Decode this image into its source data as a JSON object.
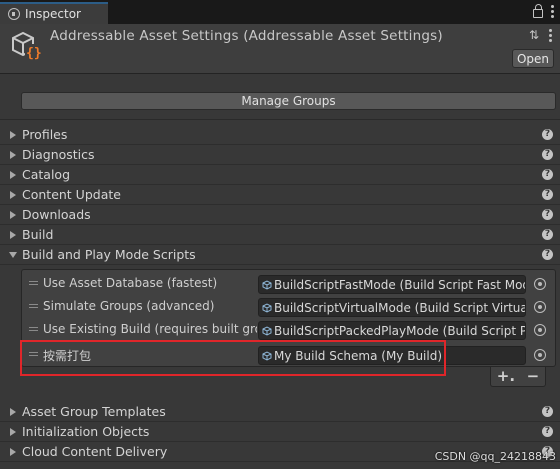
{
  "tab": {
    "label": "Inspector"
  },
  "header": {
    "title": "Addressable Asset Settings (Addressable Asset Settings)",
    "open_label": "Open"
  },
  "manage_groups_label": "Manage Groups",
  "sections_top": [
    {
      "label": "Profiles",
      "expanded": false
    },
    {
      "label": "Diagnostics",
      "expanded": false
    },
    {
      "label": "Catalog",
      "expanded": false
    },
    {
      "label": "Content Update",
      "expanded": false
    },
    {
      "label": "Downloads",
      "expanded": false
    },
    {
      "label": "Build",
      "expanded": false
    },
    {
      "label": "Build and Play Mode Scripts",
      "expanded": true
    }
  ],
  "build_scripts": [
    {
      "label": "Use Asset Database (fastest)",
      "value": "BuildScriptFastMode (Build Script Fast Mode)"
    },
    {
      "label": "Simulate Groups (advanced)",
      "value": "BuildScriptVirtualMode (Build Script Virtual Mode)"
    },
    {
      "label": "Use Existing Build (requires built groups)",
      "value": "BuildScriptPackedPlayMode (Build Script Packed Play Mode)"
    },
    {
      "label": "按需打包",
      "value": "My Build Schema (My Build)"
    }
  ],
  "list_footer": {
    "add": "+.",
    "remove": "−"
  },
  "sections_bottom": [
    {
      "label": "Asset Group Templates",
      "expanded": false
    },
    {
      "label": "Initialization Objects",
      "expanded": false
    },
    {
      "label": "Cloud Content Delivery",
      "expanded": false
    }
  ],
  "help_glyph": "?",
  "watermark": "CSDN @qq_24218843",
  "colors": {
    "background": "#383838",
    "highlight": "#e0262a",
    "tab_accent": "#2c5d87"
  }
}
